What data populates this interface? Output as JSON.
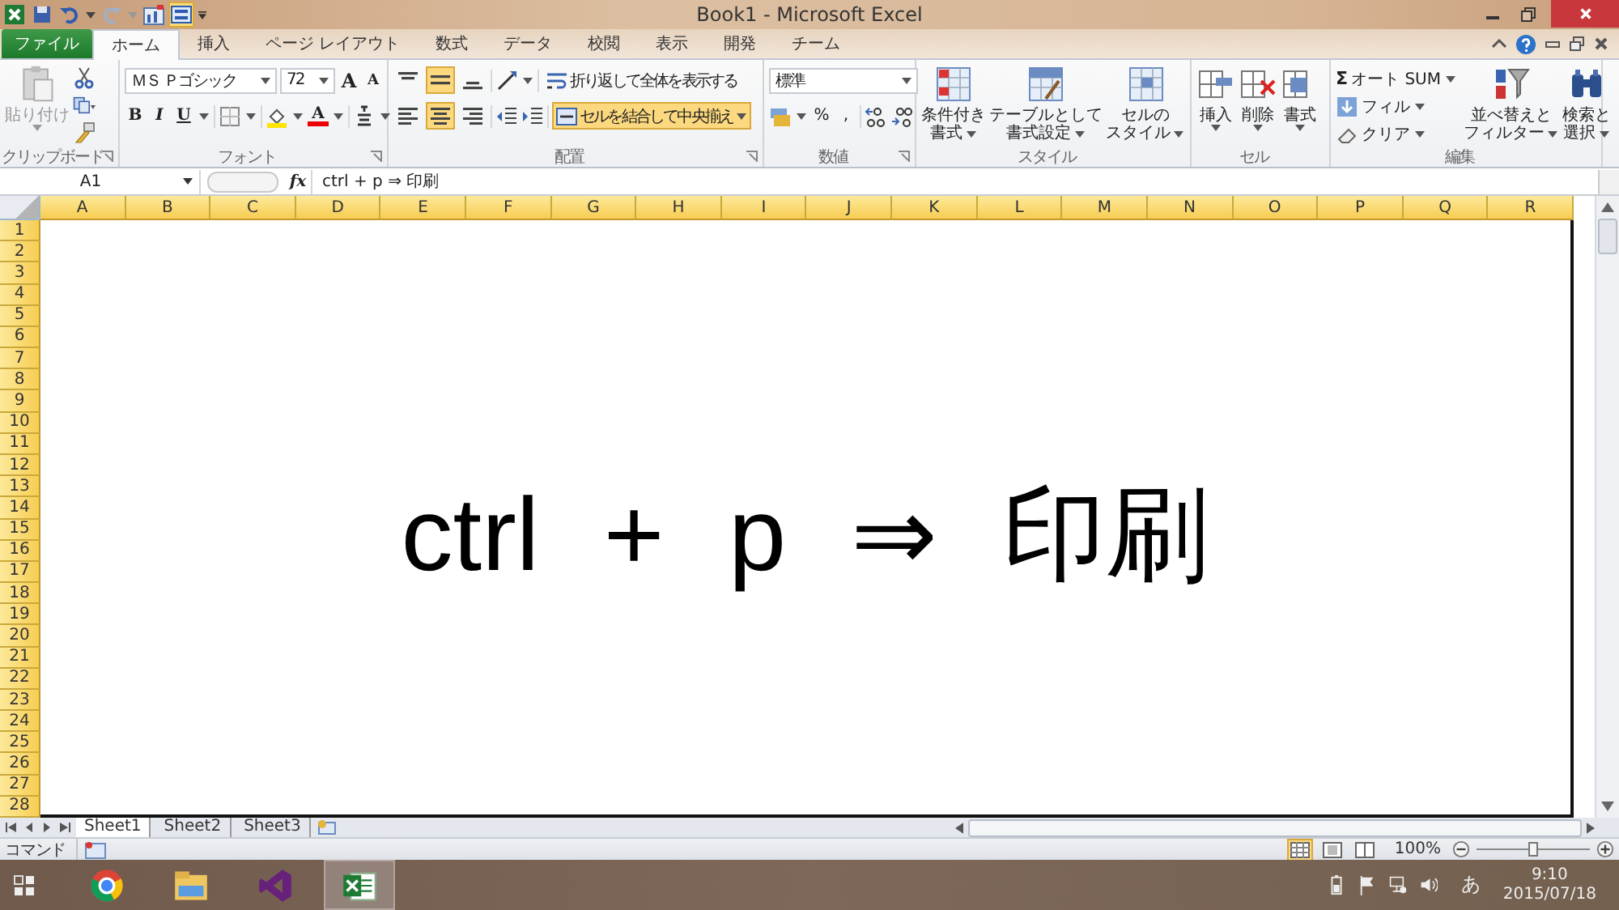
{
  "window": {
    "title": "Book1 - Microsoft Excel"
  },
  "tabs": [
    {
      "label": "ファイル",
      "kind": "file",
      "selected": false
    },
    {
      "label": "ホーム",
      "kind": "tab",
      "selected": true
    },
    {
      "label": "挿入",
      "kind": "tab",
      "selected": false
    },
    {
      "label": "ページ レイアウト",
      "kind": "tab",
      "selected": false
    },
    {
      "label": "数式",
      "kind": "tab",
      "selected": false
    },
    {
      "label": "データ",
      "kind": "tab",
      "selected": false
    },
    {
      "label": "校閲",
      "kind": "tab",
      "selected": false
    },
    {
      "label": "表示",
      "kind": "tab",
      "selected": false
    },
    {
      "label": "開発",
      "kind": "tab",
      "selected": false
    },
    {
      "label": "チーム",
      "kind": "tab",
      "selected": false
    }
  ],
  "ribbon": {
    "clipboard": {
      "label": "クリップボード",
      "paste": "貼り付け"
    },
    "font": {
      "label": "フォント",
      "name": "ＭＳ Ｐゴシック",
      "size": "72",
      "grow": "A",
      "shrink": "A",
      "bold": "B",
      "italic": "I",
      "underline": "U",
      "font_color": "A"
    },
    "alignment": {
      "label": "配置",
      "vertical_align": [
        {
          "selected": false
        },
        {
          "selected": true
        },
        {
          "selected": false
        }
      ],
      "horizontal_align": [
        {
          "selected": false
        },
        {
          "selected": true
        },
        {
          "selected": false
        }
      ],
      "wrap": {
        "label": "折り返して全体を表示する",
        "selected": false
      },
      "merge": {
        "label": "セルを結合して中央揃え",
        "selected": true
      }
    },
    "number": {
      "label": "数値",
      "format": "標準",
      "percent": "%",
      "comma": ","
    },
    "styles": {
      "label": "スタイル",
      "buttons": [
        {
          "lines": [
            "条件付き",
            "書式"
          ]
        },
        {
          "lines": [
            "テーブルとして",
            "書式設定"
          ]
        },
        {
          "lines": [
            "セルの",
            "スタイル"
          ]
        }
      ]
    },
    "cells": {
      "label": "セル",
      "buttons": [
        {
          "lines": [
            "挿入"
          ]
        },
        {
          "lines": [
            "削除"
          ]
        },
        {
          "lines": [
            "書式"
          ]
        }
      ]
    },
    "editing": {
      "label": "編集",
      "sigma": "Σ",
      "autosum": "オート SUM",
      "fill": "フィル",
      "clear": "クリア",
      "sort": [
        "並べ替えと",
        "フィルター"
      ],
      "find": [
        "検索と",
        "選択"
      ]
    }
  },
  "formula_bar": {
    "name_box": "A1",
    "fx": "fx",
    "formula": "ctrl + p ⇒ 印刷"
  },
  "sheet": {
    "columns": [
      "A",
      "B",
      "C",
      "D",
      "E",
      "F",
      "G",
      "H",
      "I",
      "J",
      "K",
      "L",
      "M",
      "N",
      "O",
      "P",
      "Q",
      "R"
    ],
    "rows": [
      "1",
      "2",
      "3",
      "4",
      "5",
      "6",
      "7",
      "8",
      "9",
      "10",
      "11",
      "12",
      "13",
      "14",
      "15",
      "16",
      "17",
      "18",
      "19",
      "20",
      "21",
      "22",
      "23",
      "24",
      "25",
      "26",
      "27",
      "28"
    ],
    "cell_text": "ctrl + p ⇒ 印刷"
  },
  "sheet_tabs": [
    {
      "label": "Sheet1",
      "selected": true
    },
    {
      "label": "Sheet2",
      "selected": false
    },
    {
      "label": "Sheet3",
      "selected": false
    }
  ],
  "status_bar": {
    "mode": "コマンド",
    "views": [
      {
        "selected": true
      },
      {
        "selected": false
      },
      {
        "selected": false
      }
    ],
    "zoom": {
      "label": "100%",
      "level": 0.5
    }
  },
  "taskbar": {
    "apps": [
      {
        "selected": false
      },
      {
        "selected": false
      },
      {
        "selected": false
      },
      {
        "selected": true
      }
    ],
    "ime": "あ",
    "time": "9:10",
    "date": "2015/07/18"
  }
}
